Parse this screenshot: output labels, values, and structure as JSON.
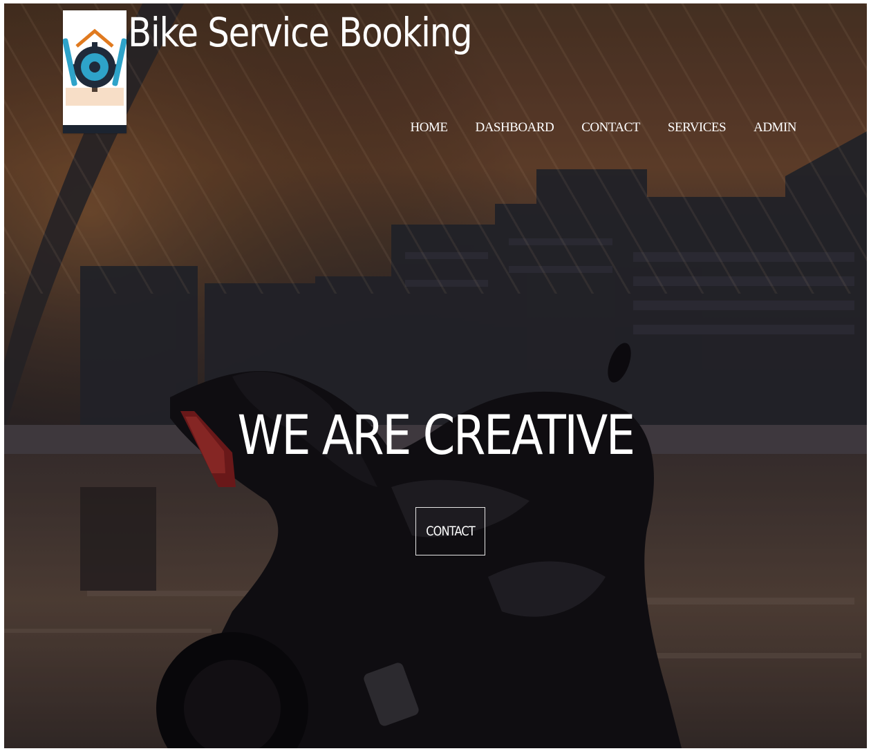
{
  "header": {
    "brand_title": "Bike Service Booking",
    "logo_alt": "Bike Service"
  },
  "nav": {
    "items": [
      {
        "label": "HOME"
      },
      {
        "label": "DASHBOARD"
      },
      {
        "label": "CONTACT"
      },
      {
        "label": "SERVICES"
      },
      {
        "label": "ADMIN"
      }
    ]
  },
  "hero": {
    "headline": "WE ARE CREATIVE",
    "cta_label": "CONTACT",
    "background": "motorcycle-at-dusk-photo"
  },
  "colors": {
    "text": "#ffffff",
    "logo_dark": "#1c2430",
    "logo_teal": "#2ea3c9",
    "logo_orange": "#e07a1f"
  }
}
